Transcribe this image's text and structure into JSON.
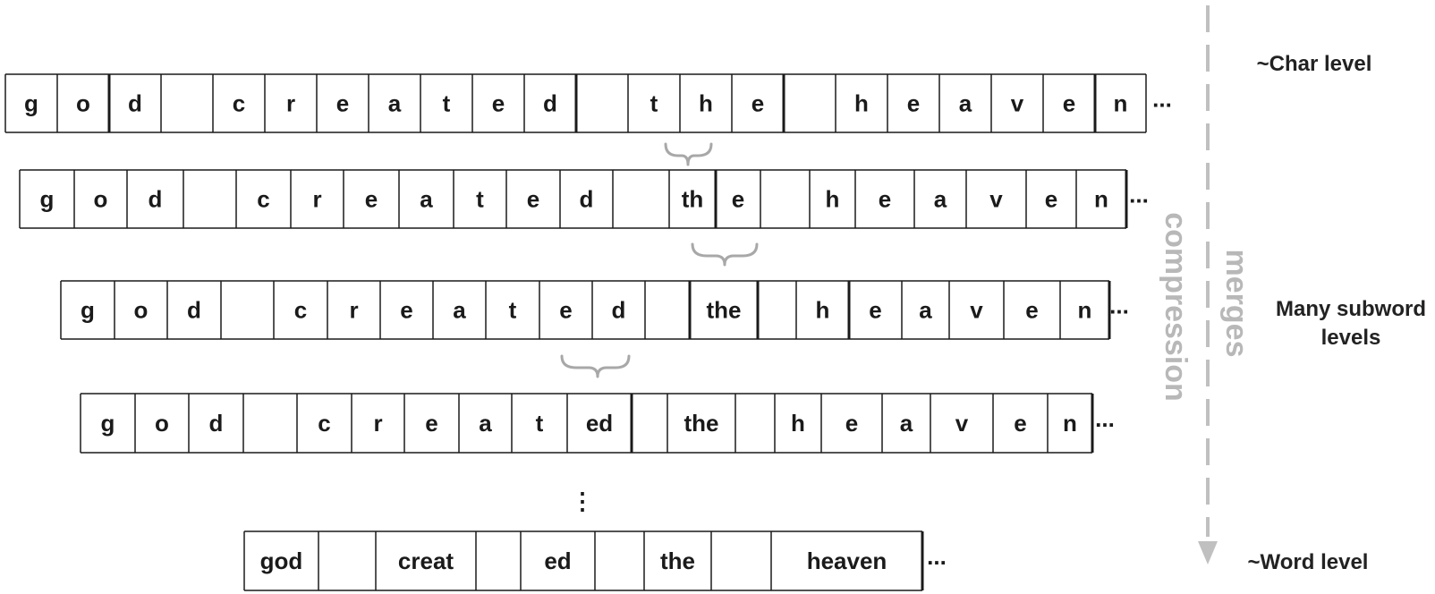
{
  "rows": [
    {
      "tokens": [
        "g",
        "o",
        "d",
        " ",
        "c",
        "r",
        "e",
        "a",
        "t",
        "e",
        "d",
        " ",
        "t",
        "h",
        "e",
        " ",
        "h",
        "e",
        "a",
        "v",
        "e",
        "n"
      ],
      "ellipsis": "..."
    },
    {
      "tokens": [
        "g",
        "o",
        "d",
        " ",
        "c",
        "r",
        "e",
        "a",
        "t",
        "e",
        "d",
        " ",
        "th",
        "e",
        " ",
        "h",
        "e",
        "a",
        "v",
        "e",
        "n"
      ],
      "ellipsis": "..."
    },
    {
      "tokens": [
        "g",
        "o",
        "d",
        " ",
        "c",
        "r",
        "e",
        "a",
        "t",
        "e",
        "d",
        " ",
        "the",
        " ",
        "h",
        "e",
        "a",
        "v",
        "e",
        "n"
      ],
      "ellipsis": "..."
    },
    {
      "tokens": [
        "g",
        "o",
        "d",
        " ",
        "c",
        "r",
        "e",
        "a",
        "t",
        "ed",
        " ",
        "the",
        " ",
        "h",
        "e",
        "a",
        "v",
        "e",
        "n"
      ],
      "ellipsis": "..."
    },
    {
      "tokens": [
        "god",
        " ",
        "creat",
        " ",
        "ed",
        " ",
        "the",
        " ",
        "heaven"
      ],
      "ellipsis": "..."
    }
  ],
  "vertical_ellipsis": "⋮",
  "labels": {
    "char_level": "~Char level",
    "subword_line1": "Many subword",
    "subword_line2": "levels",
    "word_level": "~Word level",
    "compression": "compression",
    "merges": "merges"
  },
  "colors": {
    "box_stroke": "#1a1a1a",
    "brace": "#a8a8a8",
    "arrow": "#c0c0c0",
    "side_text": "#b8b8b8"
  }
}
